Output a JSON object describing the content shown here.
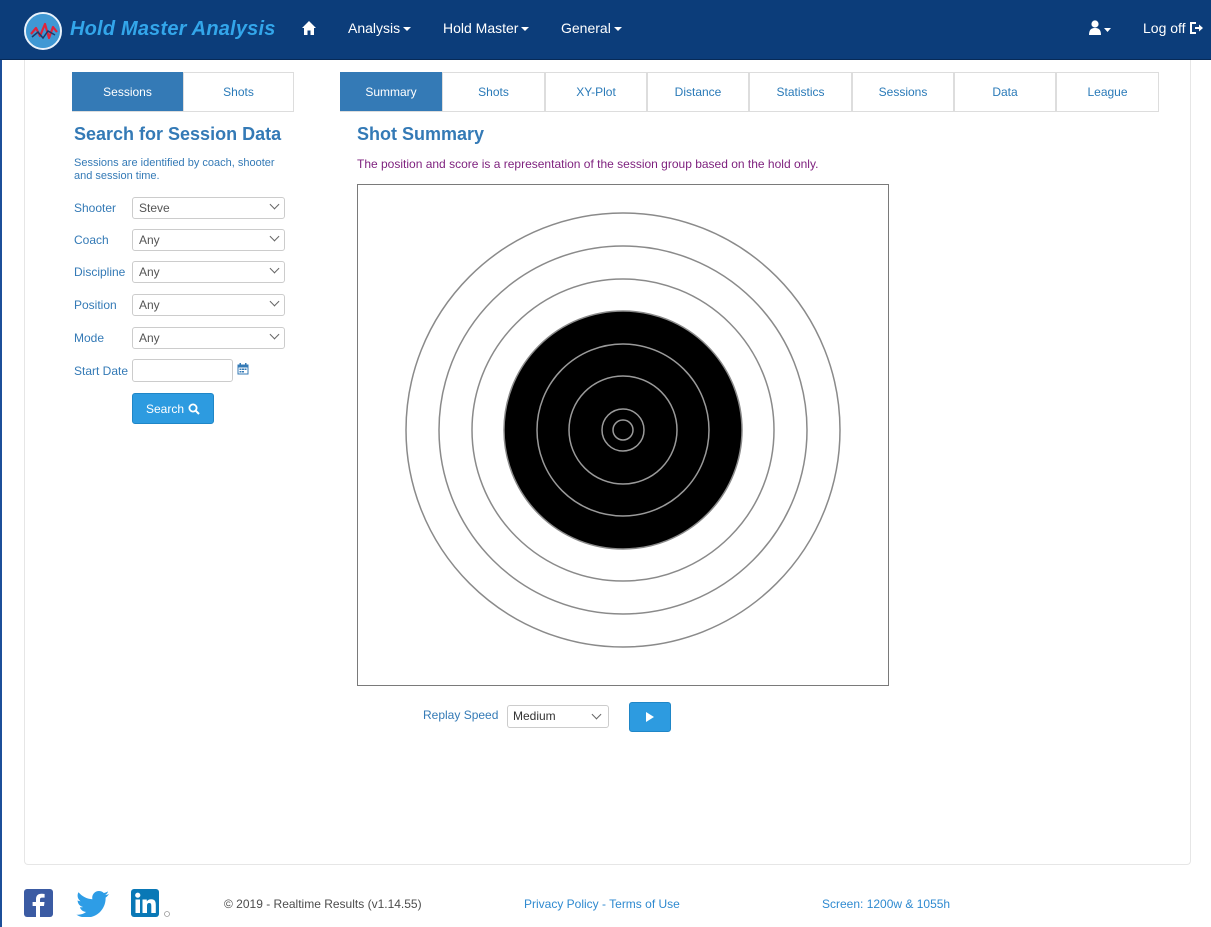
{
  "app": {
    "brand": "Hold Master Analysis",
    "colors": {
      "navbar": "#0c3d7a",
      "brand_text": "#33a6ea",
      "accent": "#347ab6",
      "button": "#2d9be0",
      "subtitle": "#7d1f7d"
    }
  },
  "navbar": {
    "home_icon": "home-icon",
    "menus": [
      {
        "label": "Analysis"
      },
      {
        "label": "Hold Master"
      },
      {
        "label": "General"
      }
    ],
    "user_icon": "user-icon",
    "logoff_label": "Log off",
    "logoff_icon": "sign-out-icon"
  },
  "left_tabs": [
    {
      "label": "Sessions",
      "active": true
    },
    {
      "label": "Shots",
      "active": false
    }
  ],
  "main_tabs": [
    {
      "label": "Summary",
      "active": true
    },
    {
      "label": "Shots",
      "active": false
    },
    {
      "label": "XY-Plot",
      "active": false
    },
    {
      "label": "Distance",
      "active": false
    },
    {
      "label": "Statistics",
      "active": false
    },
    {
      "label": "Sessions",
      "active": false
    },
    {
      "label": "Data",
      "active": false
    },
    {
      "label": "League",
      "active": false
    }
  ],
  "search": {
    "title": "Search for Session Data",
    "description": "Sessions are identified by coach, shooter and session time.",
    "fields": [
      {
        "label": "Shooter",
        "value": "Steve"
      },
      {
        "label": "Coach",
        "value": "Any"
      },
      {
        "label": "Discipline",
        "value": "Any"
      },
      {
        "label": "Position",
        "value": "Any"
      },
      {
        "label": "Mode",
        "value": "Any"
      }
    ],
    "start_date_label": "Start Date",
    "start_date_value": "",
    "calendar_icon": "calendar-icon",
    "button_label": "Search",
    "button_icon": "search-icon"
  },
  "summary": {
    "title": "Shot Summary",
    "subtitle": "The position and score is a representation of the session group based on the hold only.",
    "replay_label": "Replay Speed",
    "replay_value": "Medium",
    "play_icon": "play-icon"
  },
  "footer": {
    "social_icons": [
      "facebook-icon",
      "twitter-icon",
      "linkedin-icon"
    ],
    "copyright": "© 2019 - Realtime Results (v1.14.55)",
    "privacy": "Privacy Policy",
    "separator": " - ",
    "terms": "Terms of Use",
    "screen_info": "Screen: 1200w & 1055h"
  }
}
